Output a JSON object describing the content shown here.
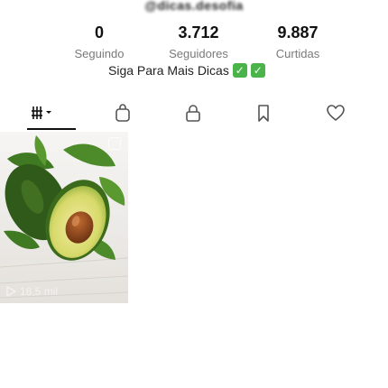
{
  "profile": {
    "handle": "@dicas.desofia"
  },
  "stats": [
    {
      "value": "0",
      "label": "Seguindo"
    },
    {
      "value": "3.712",
      "label": "Seguidores"
    },
    {
      "value": "9.887",
      "label": "Curtidas"
    }
  ],
  "promo": {
    "text": "Siga Para Mais Dicas",
    "badge": "✓"
  },
  "tabs": [
    {
      "name": "videos",
      "icon": "grid-icon"
    },
    {
      "name": "shop",
      "icon": "shopping-bag-icon"
    },
    {
      "name": "private",
      "icon": "lock-icon"
    },
    {
      "name": "saved",
      "icon": "bookmark-icon"
    },
    {
      "name": "liked",
      "icon": "heart-icon"
    }
  ],
  "videos": [
    {
      "views": "18,5 mil",
      "subject": "avocado"
    }
  ],
  "colors": {
    "accent_check": "#4ab34a",
    "label_gray": "#7a7a7a"
  }
}
